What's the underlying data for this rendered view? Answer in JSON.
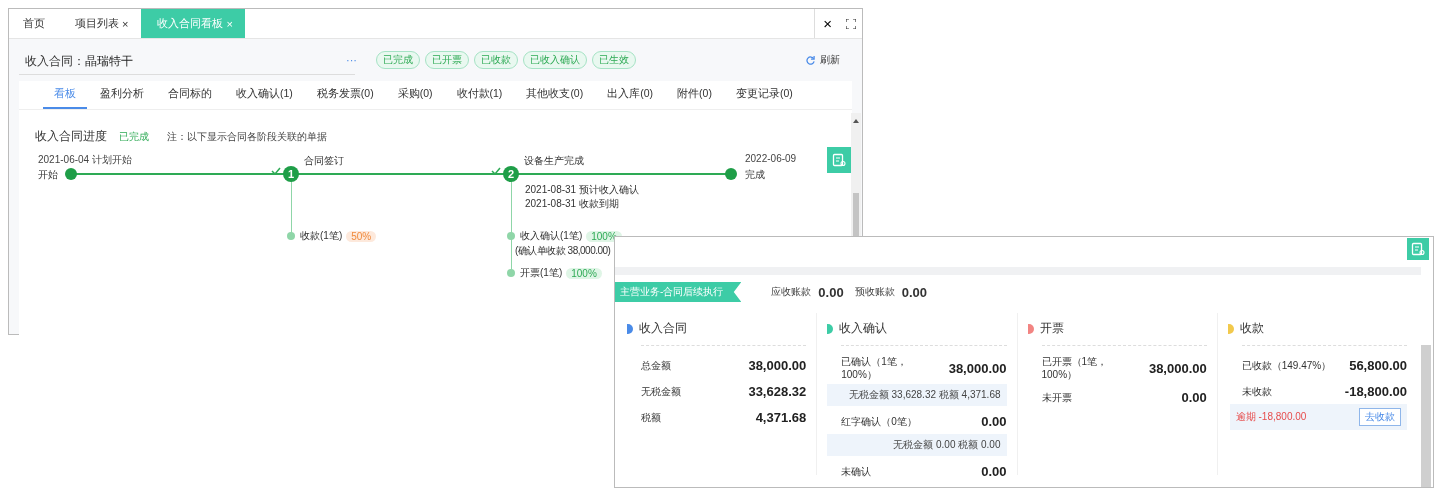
{
  "main_window": {
    "tabs": [
      {
        "label": "首页",
        "selected": false
      },
      {
        "label": "项目列表",
        "close": "×",
        "selected": false
      },
      {
        "label": "收入合同看板",
        "close": "×",
        "selected": true
      }
    ],
    "close_label": "×",
    "header": {
      "label": "收入合同：",
      "value": "晶瑞特干",
      "more": "···",
      "badges": [
        "已完成",
        "已开票",
        "已收款",
        "已收入确认",
        "已生效"
      ],
      "refresh": "刷新"
    },
    "subtabs": [
      {
        "label": "看板",
        "selected": true
      },
      {
        "label": "盈利分析",
        "selected": false
      },
      {
        "label": "合同标的",
        "selected": false
      },
      {
        "label": "收入确认(1)",
        "selected": false
      },
      {
        "label": "税务发票(0)",
        "selected": false
      },
      {
        "label": "采购(0)",
        "selected": false
      },
      {
        "label": "收付款(1)",
        "selected": false
      },
      {
        "label": "其他收支(0)",
        "selected": false
      },
      {
        "label": "出入库(0)",
        "selected": false
      },
      {
        "label": "附件(0)",
        "selected": false
      },
      {
        "label": "变更记录(0)",
        "selected": false
      }
    ],
    "progress": {
      "title": "收入合同进度",
      "status": "已完成",
      "note": "注：以下显示合同各阶段关联的单据",
      "milestones": [
        {
          "kind": "start",
          "label": "开始",
          "date": "2021-06-04 计划开始"
        },
        {
          "kind": "step",
          "number": "1",
          "label": "合同签订",
          "done": true,
          "documents": [
            {
              "label": "收款(1笔)",
              "percent": "50%",
              "complete": false
            }
          ]
        },
        {
          "kind": "step",
          "number": "2",
          "label": "设备生产完成",
          "done": true,
          "events": [
            "2021-08-31 预计收入确认",
            "2021-08-31 收款到期"
          ],
          "documents": [
            {
              "label": "收入确认(1笔)",
              "percent": "100%",
              "complete": true,
              "detail": "(确认单收款 38,000.00)"
            },
            {
              "label": "开票(1笔)",
              "percent": "100%",
              "complete": true
            }
          ]
        },
        {
          "kind": "end",
          "label": "完成",
          "date": "2022-06-09"
        }
      ]
    }
  },
  "detail_window": {
    "banner": "主营业务-合同后续执行",
    "totals": [
      {
        "label": "应收账款",
        "value": "0.00"
      },
      {
        "label": "预收账款",
        "value": "0.00"
      }
    ],
    "sections": [
      {
        "title": "收入合同",
        "color": "#4a8be8",
        "rows": [
          {
            "label": "总金额",
            "value": "38,000.00"
          },
          {
            "label": "无税金额",
            "value": "33,628.32"
          },
          {
            "label": "税额",
            "value": "4,371.68"
          }
        ]
      },
      {
        "title": "收入确认",
        "color": "#3dcca6",
        "rows": [
          {
            "label": "已确认（1笔，100%）",
            "value": "38,000.00",
            "detail": "无税金额 33,628.32 税额 4,371.68"
          },
          {
            "label": "红字确认（0笔）",
            "value": "0.00",
            "detail": "无税金额 0.00 税额 0.00"
          },
          {
            "label": "未确认",
            "value": "0.00"
          }
        ]
      },
      {
        "title": "开票",
        "color": "#f28482",
        "rows": [
          {
            "label": "已开票（1笔，100%）",
            "value": "38,000.00"
          },
          {
            "label": "未开票",
            "value": "0.00"
          }
        ]
      },
      {
        "title": "收款",
        "color": "#f2c94c",
        "rows": [
          {
            "label": "已收款（149.47%）",
            "value": "56,800.00"
          },
          {
            "label": "未收款",
            "value": "-18,800.00",
            "overdue": {
              "text": "逾期 -18,800.00",
              "action": "去收款"
            }
          }
        ]
      }
    ]
  }
}
